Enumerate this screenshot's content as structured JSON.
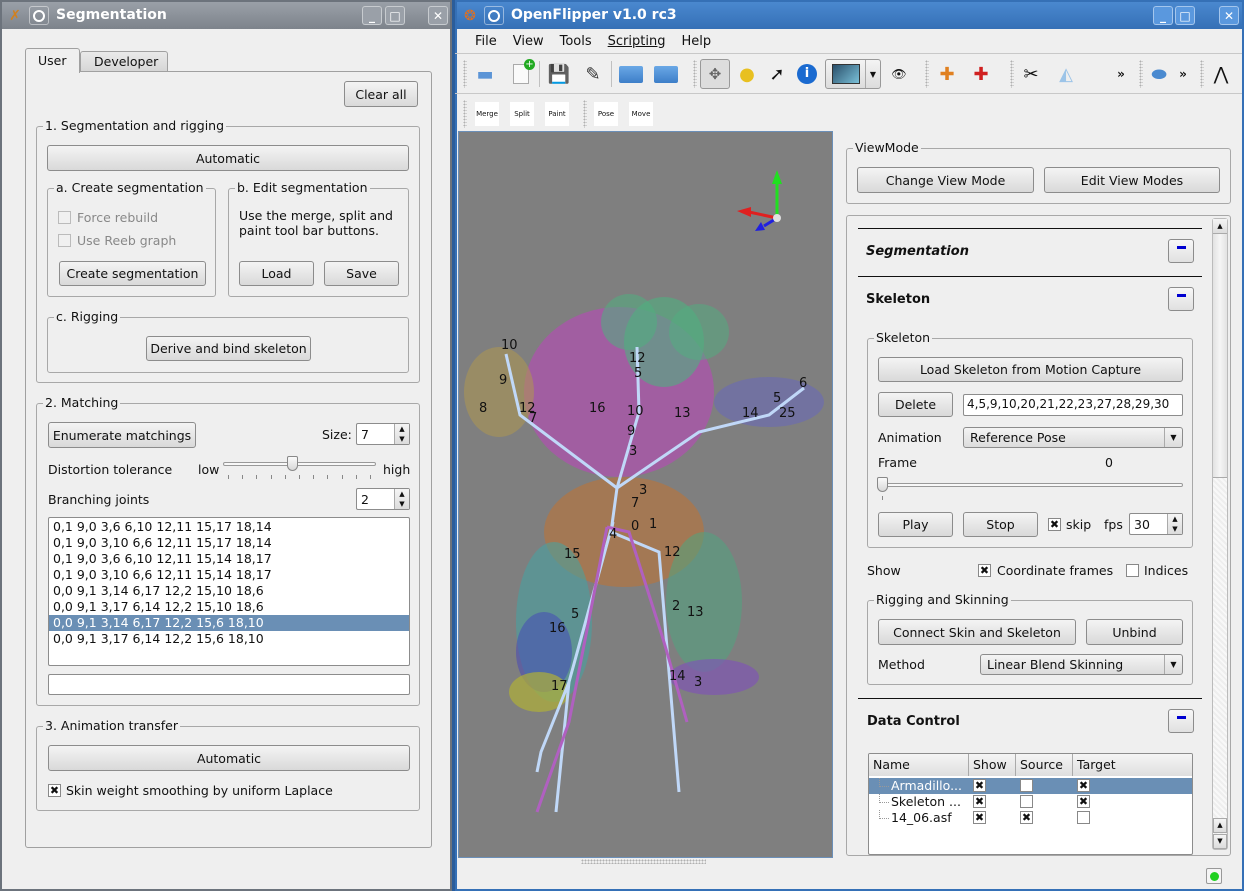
{
  "seg_window": {
    "title": "Segmentation",
    "tabs": [
      {
        "label": "User",
        "active": true
      },
      {
        "label": "Developer",
        "active": false
      }
    ],
    "clear_all": "Clear all",
    "group1": {
      "title": "1. Segmentation and rigging",
      "automatic": "Automatic",
      "create": {
        "title": "a. Create segmentation",
        "force_rebuild": {
          "label": "Force rebuild",
          "checked": false,
          "enabled": false
        },
        "use_reeb": {
          "label": "Use Reeb graph",
          "checked": false,
          "enabled": false
        },
        "button": "Create segmentation"
      },
      "edit": {
        "title": "b. Edit segmentation",
        "hint_line1": "Use the merge, split and",
        "hint_line2": "paint tool bar buttons.",
        "load": "Load",
        "save": "Save"
      },
      "rigging": {
        "title": "c. Rigging",
        "button": "Derive and bind skeleton"
      }
    },
    "group2": {
      "title": "2. Matching",
      "enumerate": "Enumerate matchings",
      "size_label": "Size:",
      "size_value": "7",
      "distortion_label": "Distortion tolerance",
      "low": "low",
      "high": "high",
      "distortion_fraction": 0.45,
      "branching_label": "Branching joints",
      "branching_value": "2",
      "matchings": [
        "0,1 9,0 3,6 6,10 12,11 15,17 18,14",
        "0,1 9,0 3,10 6,6 12,11 15,17 18,14",
        "0,1 9,0 3,6 6,10 12,11 15,14 18,17",
        "0,1 9,0 3,10 6,6 12,11 15,14 18,17",
        "0,0 9,1 3,14 6,17 12,2 15,10 18,6",
        "0,0 9,1 3,17 6,14 12,2 15,10 18,6",
        "0,0 9,1 3,14 6,17 12,2 15,6 18,10",
        "0,0 9,1 3,17 6,14 12,2 15,6 18,10"
      ],
      "selected_index": 6,
      "text_field": ""
    },
    "group3": {
      "title": "3. Animation transfer",
      "automatic": "Automatic",
      "smoothing": {
        "label": "Skin weight smoothing by uniform Laplace",
        "checked": true
      }
    }
  },
  "of_window": {
    "title": "OpenFlipper v1.0 rc3",
    "menu": [
      "File",
      "View",
      "Tools",
      "Scripting",
      "Help"
    ],
    "toolbar_icons": [
      "print-icon",
      "new-object-icon",
      "save-icon",
      "save-as-icon",
      "open-folder-icon",
      "edit-folder-icon",
      "move-tool-icon",
      "light-icon",
      "pointer-icon",
      "info-icon",
      "draw-mode-icon",
      "eye-icon",
      "move-cube-icon",
      "move-cube-red-icon",
      "scissors-icon",
      "selection-icon",
      "more-icon",
      "eraser-icon",
      "more-icon",
      "skeleton-icon"
    ],
    "toolbar2": [
      "Merge",
      "Split",
      "Paint",
      "Pose",
      "Move"
    ],
    "viewmode": {
      "title": "ViewMode",
      "change": "Change View Mode",
      "edit": "Edit View Modes"
    },
    "sections": {
      "segmentation": "Segmentation",
      "skeleton": "Skeleton",
      "data_control": "Data Control"
    },
    "skeleton": {
      "group_title": "Skeleton",
      "load_mocap": "Load Skeleton from Motion Capture",
      "delete": "Delete",
      "delete_field": "4,5,9,10,20,21,22,23,27,28,29,30",
      "animation_label": "Animation",
      "animation_value": "Reference Pose",
      "frame_label": "Frame",
      "frame_value": "0",
      "frame_fraction": 0,
      "play": "Play",
      "stop": "Stop",
      "skip_label": "skip",
      "skip_checked": true,
      "fps_label": "fps",
      "fps_value": "30"
    },
    "show": {
      "label": "Show",
      "coord_frames": {
        "label": "Coordinate frames",
        "checked": true
      },
      "indices": {
        "label": "Indices",
        "checked": false
      }
    },
    "rigging": {
      "title": "Rigging and Skinning",
      "connect": "Connect Skin and Skeleton",
      "unbind": "Unbind",
      "method_label": "Method",
      "method_value": "Linear Blend Skinning"
    },
    "data_table": {
      "columns": [
        "Name",
        "Show",
        "Source",
        "Target"
      ],
      "rows": [
        {
          "name": "Armadillo...",
          "show": true,
          "source": false,
          "target": true,
          "selected": true
        },
        {
          "name": "Skeleton ...",
          "show": true,
          "source": false,
          "target": true,
          "selected": false
        },
        {
          "name": "14_06.asf",
          "show": true,
          "source": true,
          "target": false,
          "selected": false
        }
      ]
    },
    "viewport_labels": [
      "10",
      "9",
      "8",
      "12",
      "7",
      "16",
      "12",
      "5",
      "10",
      "9",
      "3",
      "13",
      "14",
      "6",
      "5",
      "25",
      "3",
      "7",
      "0",
      "1",
      "4",
      "15",
      "12",
      "2",
      "13",
      "5",
      "16",
      "14",
      "3",
      "17"
    ]
  }
}
